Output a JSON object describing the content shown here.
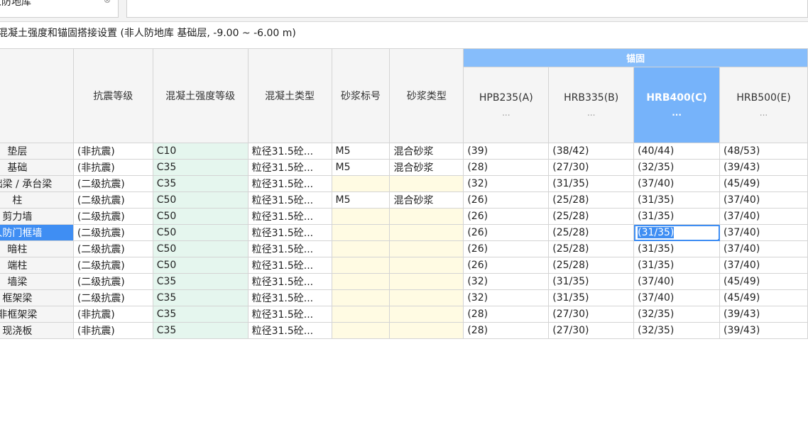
{
  "top": {
    "layer_name": "人防地库",
    "clear_glyph": "⊗"
  },
  "section_title": "混凝土强度和锚固搭接设置 (非人防地库  基础层, -9.00 ~ -6.00 m)",
  "table": {
    "group_header": "锚固",
    "columns": [
      "抗震等级",
      "混凝土强度等级",
      "混凝土类型",
      "砂浆标号",
      "砂浆类型",
      "HPB235(A)",
      "HRB335(B)",
      "HRB400(C)",
      "HRB500(E)"
    ],
    "ellipsis": "...",
    "rows": [
      {
        "name": "垫层",
        "seismic": "(非抗震)",
        "grade": "C10",
        "ctype": "粒径31.5砼...",
        "mortar": "M5",
        "mtype": "混合砂浆",
        "a": "(39)",
        "b": "(38/42)",
        "c": "(40/44)",
        "e": "(48/53)"
      },
      {
        "name": "基础",
        "seismic": "(非抗震)",
        "grade": "C35",
        "ctype": "粒径31.5砼...",
        "mortar": "M5",
        "mtype": "混合砂浆",
        "a": "(28)",
        "b": "(27/30)",
        "c": "(32/35)",
        "e": "(39/43)"
      },
      {
        "name": "基础梁 / 承台梁",
        "seismic": "(二级抗震)",
        "grade": "C35",
        "ctype": "粒径31.5砼...",
        "mortar": "",
        "mtype": "",
        "a": "(32)",
        "b": "(31/35)",
        "c": "(37/40)",
        "e": "(45/49)"
      },
      {
        "name": "柱",
        "seismic": "(二级抗震)",
        "grade": "C50",
        "ctype": "粒径31.5砼...",
        "mortar": "M5",
        "mtype": "混合砂浆",
        "a": "(26)",
        "b": "(25/28)",
        "c": "(31/35)",
        "e": "(37/40)"
      },
      {
        "name": "剪力墙",
        "seismic": "(二级抗震)",
        "grade": "C50",
        "ctype": "粒径31.5砼...",
        "mortar": "",
        "mtype": "",
        "a": "(26)",
        "b": "(25/28)",
        "c": "(31/35)",
        "e": "(37/40)"
      },
      {
        "name": "人防门框墙",
        "seismic": "(二级抗震)",
        "grade": "C50",
        "ctype": "粒径31.5砼...",
        "mortar": "",
        "mtype": "",
        "a": "(26)",
        "b": "(25/28)",
        "c": "(31/35)",
        "e": "(37/40)"
      },
      {
        "name": "暗柱",
        "seismic": "(二级抗震)",
        "grade": "C50",
        "ctype": "粒径31.5砼...",
        "mortar": "",
        "mtype": "",
        "a": "(26)",
        "b": "(25/28)",
        "c": "(31/35)",
        "e": "(37/40)"
      },
      {
        "name": "端柱",
        "seismic": "(二级抗震)",
        "grade": "C50",
        "ctype": "粒径31.5砼...",
        "mortar": "",
        "mtype": "",
        "a": "(26)",
        "b": "(25/28)",
        "c": "(31/35)",
        "e": "(37/40)"
      },
      {
        "name": "墙梁",
        "seismic": "(二级抗震)",
        "grade": "C35",
        "ctype": "粒径31.5砼...",
        "mortar": "",
        "mtype": "",
        "a": "(32)",
        "b": "(31/35)",
        "c": "(37/40)",
        "e": "(45/49)"
      },
      {
        "name": "框架梁",
        "seismic": "(二级抗震)",
        "grade": "C35",
        "ctype": "粒径31.5砼...",
        "mortar": "",
        "mtype": "",
        "a": "(32)",
        "b": "(31/35)",
        "c": "(37/40)",
        "e": "(45/49)"
      },
      {
        "name": "非框架梁",
        "seismic": "(非抗震)",
        "grade": "C35",
        "ctype": "粒径31.5砼...",
        "mortar": "",
        "mtype": "",
        "a": "(28)",
        "b": "(27/30)",
        "c": "(32/35)",
        "e": "(39/43)"
      },
      {
        "name": "现浇板",
        "seismic": "(非抗震)",
        "grade": "C35",
        "ctype": "粒径31.5砼...",
        "mortar": "",
        "mtype": "",
        "a": "(28)",
        "b": "(27/30)",
        "c": "(32/35)",
        "e": "(39/43)"
      }
    ]
  },
  "selection": {
    "row_index": 5,
    "column": "c"
  }
}
